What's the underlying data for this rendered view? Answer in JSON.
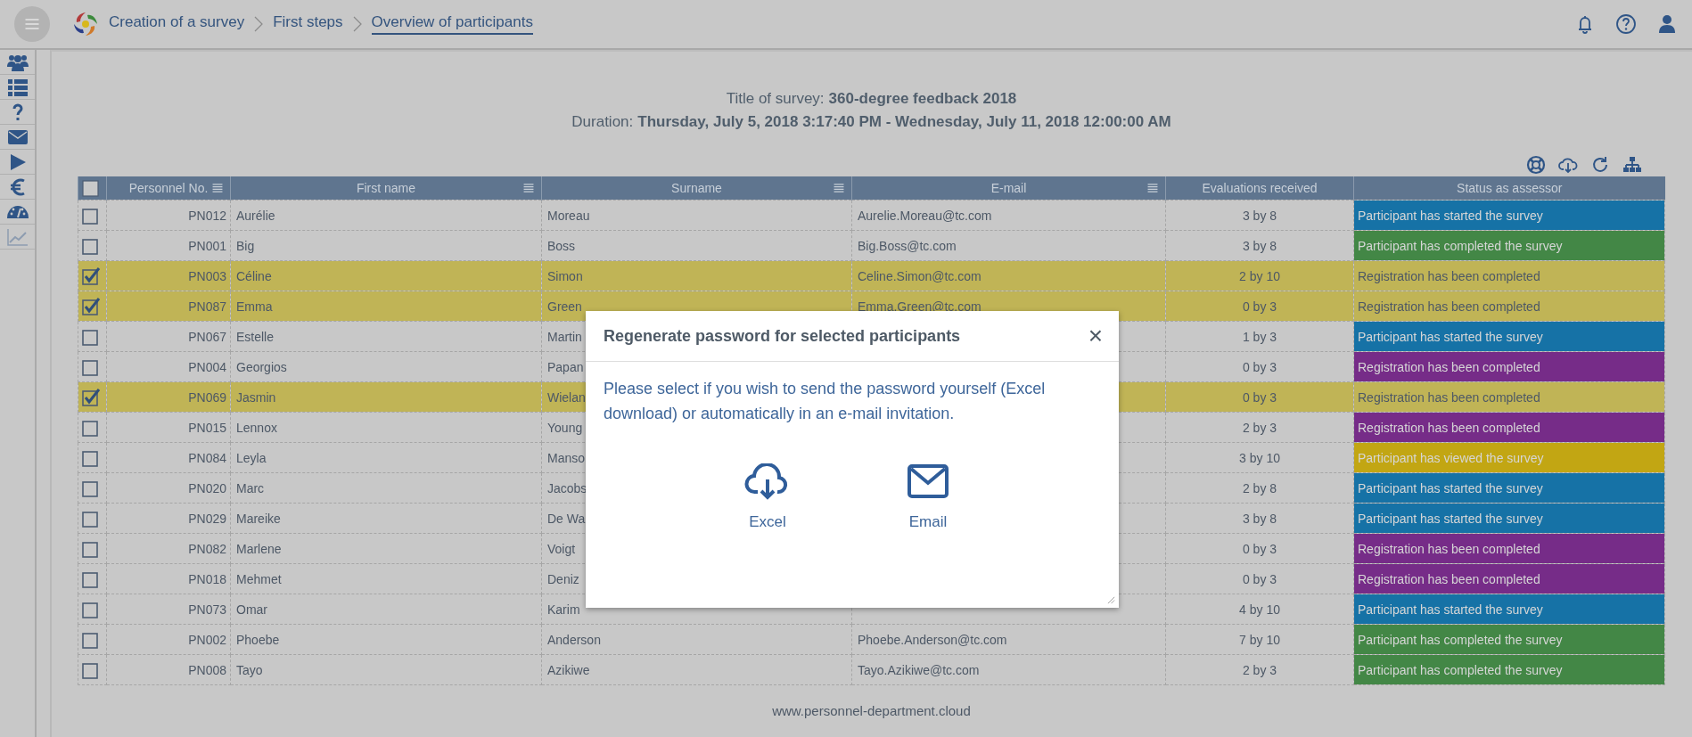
{
  "breadcrumbs": [
    {
      "label": "Creation of a survey",
      "selected": false
    },
    {
      "label": "First steps",
      "selected": false
    },
    {
      "label": "Overview of participants",
      "selected": true
    }
  ],
  "sidebar": {
    "items": [
      {
        "disabled": false
      },
      {
        "disabled": false
      },
      {
        "disabled": false
      },
      {
        "disabled": false
      },
      {
        "disabled": false
      },
      {
        "disabled": false
      },
      {
        "disabled": false
      },
      {
        "disabled": true
      }
    ]
  },
  "survey_info": {
    "title_label": "Title of survey:",
    "title": "360-degree feedback 2018",
    "duration_label": "Duration:",
    "duration": "Thursday, July 5, 2018 3:17:40 PM - Wednesday, July 11, 2018 12:00:00 AM"
  },
  "table": {
    "select_all": {
      "checked": false
    },
    "columns": [
      {
        "label": "Personnel No.",
        "menu": true
      },
      {
        "label": "First name",
        "menu": true
      },
      {
        "label": "Surname",
        "menu": true
      },
      {
        "label": "E-mail",
        "menu": true
      },
      {
        "label": "Evaluations received",
        "menu": false
      },
      {
        "label": "Status as assessor",
        "menu": false
      }
    ],
    "rows": [
      {
        "selected": false,
        "personnel_no": "PN012",
        "first_name": "Aurélie",
        "surname": "Moreau",
        "email": "Aurelie.Moreau@tc.com",
        "evaluations": "3 by 8",
        "status": "Participant has started the survey",
        "color": "#1672a6"
      },
      {
        "selected": false,
        "personnel_no": "PN001",
        "first_name": "Big",
        "surname": "Boss",
        "email": "Big.Boss@tc.com",
        "evaluations": "3 by 8",
        "status": "Participant has completed the survey",
        "color": "#438746"
      },
      {
        "selected": true,
        "personnel_no": "PN003",
        "first_name": "Céline",
        "surname": "Simon",
        "email": "Celine.Simon@tc.com",
        "evaluations": "2 by 10",
        "status": "Registration has been completed"
      },
      {
        "selected": true,
        "personnel_no": "PN087",
        "first_name": "Emma",
        "surname": "Green",
        "email": "Emma.Green@tc.com",
        "evaluations": "0 by 3",
        "status": "Registration has been completed"
      },
      {
        "selected": false,
        "personnel_no": "PN067",
        "first_name": "Estelle",
        "surname": "Martin",
        "evaluations": "1 by 3",
        "status": "Participant has started the survey",
        "color": "#1672a6"
      },
      {
        "selected": false,
        "personnel_no": "PN004",
        "first_name": "Georgios",
        "surname": "Papan",
        "evaluations": "0 by 3",
        "status": "Registration has been completed",
        "color": "#762c88"
      },
      {
        "selected": true,
        "personnel_no": "PN069",
        "first_name": "Jasmin",
        "surname": "Wielan",
        "evaluations": "0 by 3",
        "status": "Registration has been completed"
      },
      {
        "selected": false,
        "personnel_no": "PN015",
        "first_name": "Lennox",
        "surname": "Young",
        "evaluations": "2 by 3",
        "status": "Registration has been completed",
        "color": "#762c88"
      },
      {
        "selected": false,
        "personnel_no": "PN084",
        "first_name": "Leyla",
        "surname": "Manso",
        "evaluations": "3 by 10",
        "status": "Participant has viewed the survey",
        "color": "#c2a613"
      },
      {
        "selected": false,
        "personnel_no": "PN020",
        "first_name": "Marc",
        "surname": "Jacobs",
        "evaluations": "2 by 8",
        "status": "Participant has started the survey",
        "color": "#1672a6"
      },
      {
        "selected": false,
        "personnel_no": "PN029",
        "first_name": "Mareike",
        "surname": "De Wa",
        "evaluations": "3 by 8",
        "status": "Participant has started the survey",
        "color": "#1672a6"
      },
      {
        "selected": false,
        "personnel_no": "PN082",
        "first_name": "Marlene",
        "surname": "Voigt",
        "evaluations": "0 by 3",
        "status": "Registration has been completed",
        "color": "#762c88"
      },
      {
        "selected": false,
        "personnel_no": "PN018",
        "first_name": "Mehmet",
        "surname": "Deniz",
        "evaluations": "0 by 3",
        "status": "Registration has been completed",
        "color": "#762c88"
      },
      {
        "selected": false,
        "personnel_no": "PN073",
        "first_name": "Omar",
        "surname": "Karim",
        "evaluations": "4 by 10",
        "status": "Participant has started the survey",
        "color": "#1672a6"
      },
      {
        "selected": false,
        "personnel_no": "PN002",
        "first_name": "Phoebe",
        "surname": "Anderson",
        "email": "Phoebe.Anderson@tc.com",
        "evaluations": "7 by 10",
        "status": "Participant has completed the survey",
        "color": "#438746"
      },
      {
        "selected": false,
        "personnel_no": "PN008",
        "first_name": "Tayo",
        "surname": "Azikiwe",
        "email": "Tayo.Azikiwe@tc.com",
        "evaluations": "2 by 3",
        "status": "Participant has completed the survey",
        "color": "#438746"
      }
    ]
  },
  "footer": "www.personnel-department.cloud",
  "dialog": {
    "title": "Regenerate password for selected participants",
    "close": "×",
    "message": "Please select if you wish to send the password yourself (Excel download) or automatically in an e-mail invitation.",
    "options": [
      {
        "kind": "download",
        "label": "Excel"
      },
      {
        "kind": "email",
        "label": "Email"
      }
    ]
  }
}
